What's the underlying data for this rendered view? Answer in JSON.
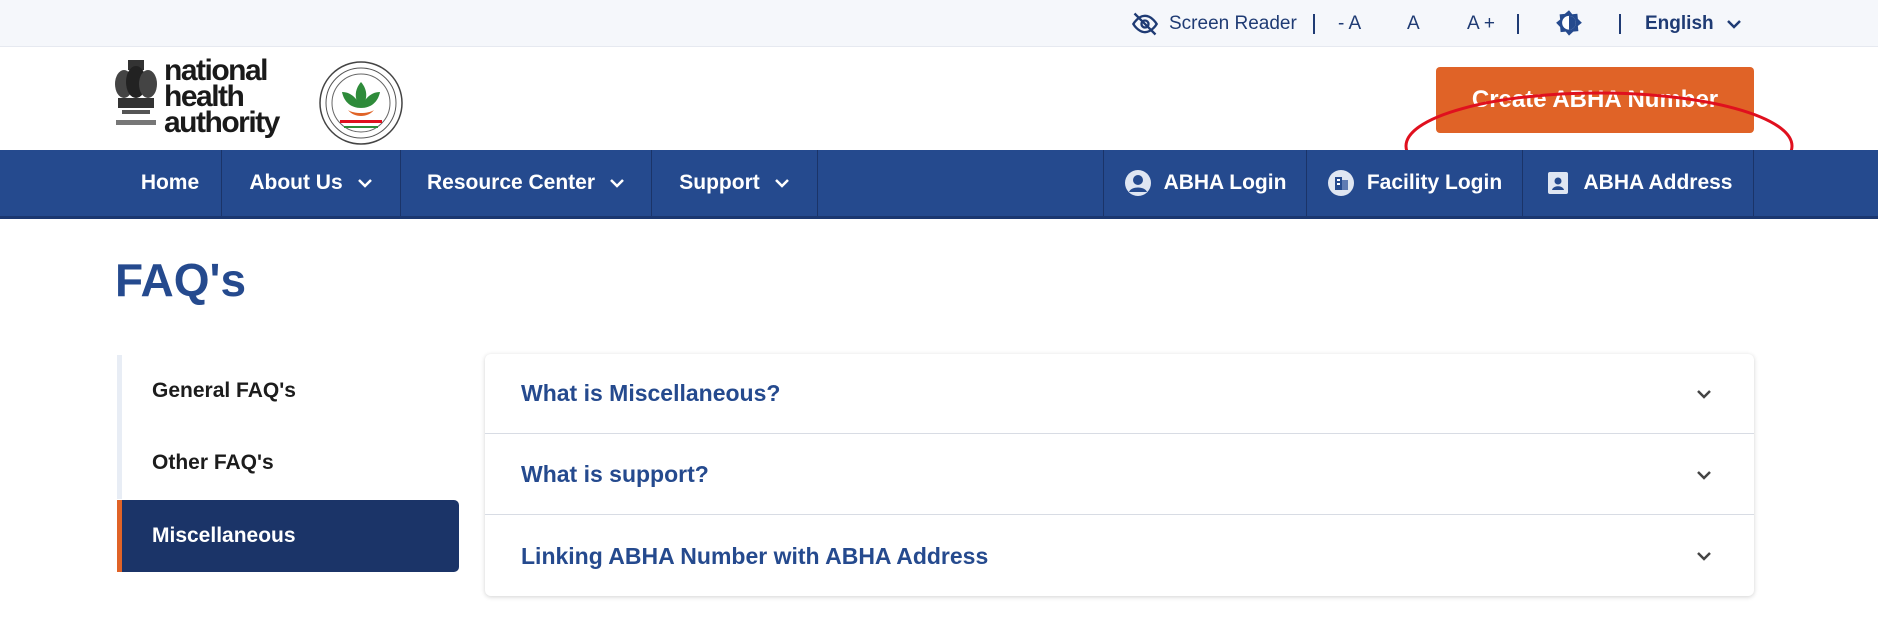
{
  "utility": {
    "screen_reader": "Screen Reader",
    "font_decrease": "- A",
    "font_normal": "A",
    "font_increase": "A +",
    "contrast_icon": "contrast-icon",
    "language": "English"
  },
  "header": {
    "org_name_line1": "national",
    "org_name_line2": "health",
    "org_name_line3": "authority",
    "create_button": "Create ABHA Number"
  },
  "nav": {
    "items": [
      {
        "label": "Home"
      },
      {
        "label": "About Us"
      },
      {
        "label": "Resource Center"
      },
      {
        "label": "Support"
      }
    ],
    "logins": [
      {
        "label": "ABHA Login",
        "icon": "user-icon"
      },
      {
        "label": "Facility Login",
        "icon": "building-icon"
      },
      {
        "label": "ABHA Address",
        "icon": "id-card-icon"
      }
    ]
  },
  "page": {
    "title": "FAQ's"
  },
  "sidebar": {
    "items": [
      {
        "label": "General FAQ's"
      },
      {
        "label": "Other FAQ's"
      },
      {
        "label": "Miscellaneous",
        "active": true
      }
    ]
  },
  "faqs": [
    {
      "question": "What is Miscellaneous?"
    },
    {
      "question": "What is support?"
    },
    {
      "question": "Linking ABHA Number with ABHA Address"
    }
  ],
  "colors": {
    "primary": "#254a8e",
    "accent": "#e06327",
    "active": "#1b3468",
    "highlight": "#e0101e"
  }
}
